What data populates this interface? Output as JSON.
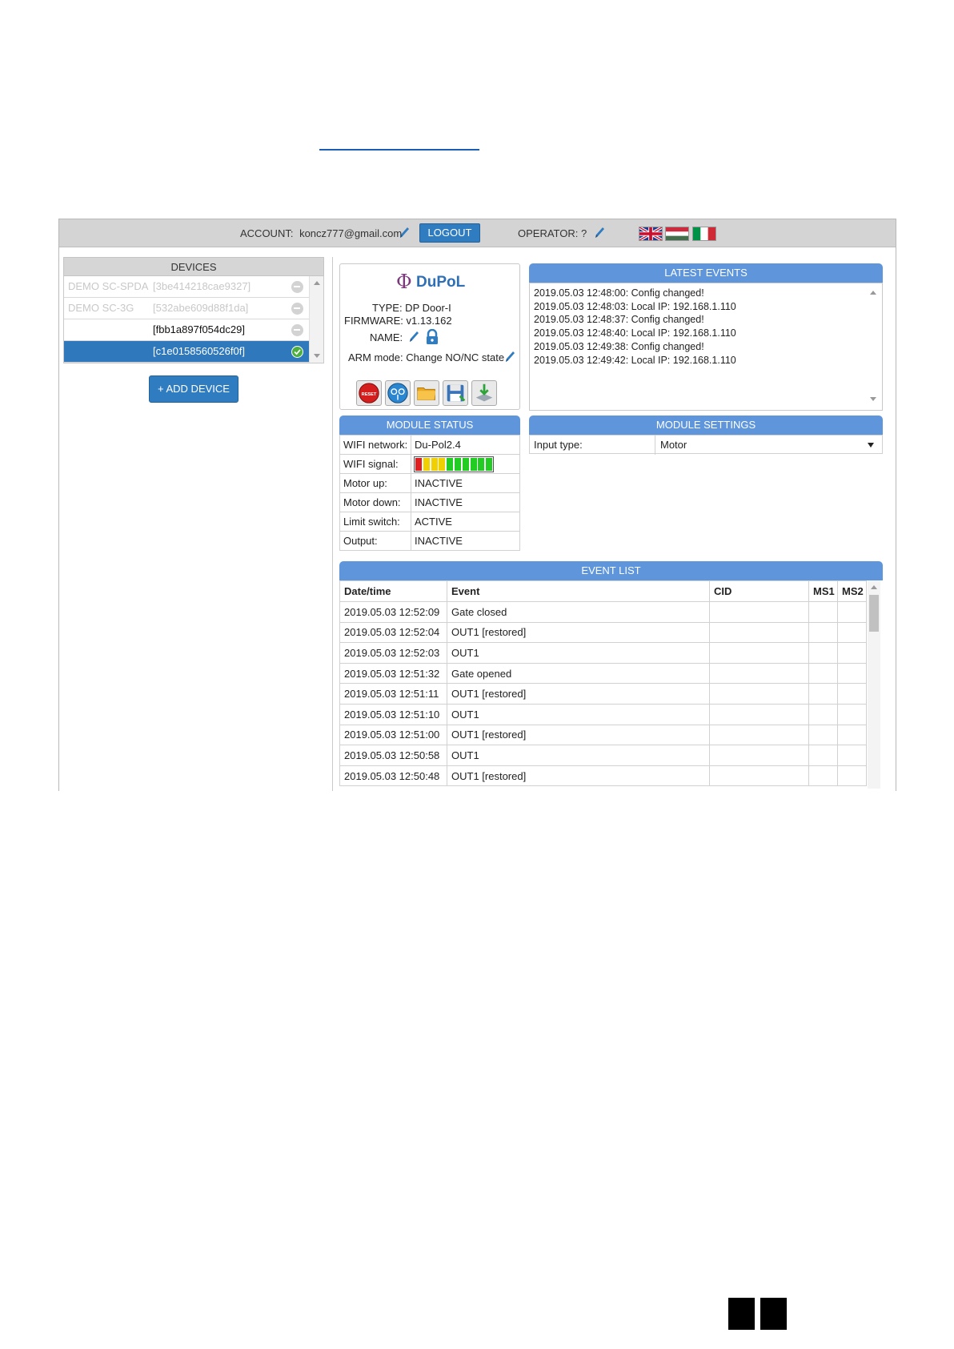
{
  "topbar": {
    "account_label": "ACCOUNT:",
    "account_email": "koncz777@gmail.com",
    "logout_label": "LOGOUT",
    "operator_label": "OPERATOR: ?",
    "languages": [
      "English",
      "Hungarian",
      "Italian"
    ]
  },
  "devices": {
    "title": "DEVICES",
    "items": [
      {
        "name": "DEMO SC-SPDA",
        "id": "[3be414218cae9327]",
        "status": "inactive"
      },
      {
        "name": "DEMO SC-3G",
        "id": "[532abe609d88f1da]",
        "status": "inactive"
      },
      {
        "name": "",
        "id": "[fbb1a897f054dc29]",
        "status": "inactive"
      },
      {
        "name": "",
        "id": "[c1e0158560526f0f]",
        "status": "online"
      }
    ],
    "add_label": "+ ADD DEVICE"
  },
  "device_info": {
    "logo_text": "DuPoL",
    "type": "TYPE: DP Door-I",
    "firmware": "FIRMWARE: v1.13.162",
    "name_label": "NAME:",
    "arm_mode": "ARM mode: Change NO/NC state",
    "tools": [
      "reset-icon",
      "remote-icon",
      "folder-icon",
      "save-icon",
      "download-icon"
    ],
    "reset_text": "RESET"
  },
  "latest_events": {
    "title": "LATEST EVENTS",
    "lines": [
      "2019.05.03 12:48:00: Config changed!",
      "2019.05.03 12:48:03: Local IP: 192.168.1.110",
      "2019.05.03 12:48:37: Config changed!",
      "2019.05.03 12:48:40: Local IP: 192.168.1.110",
      "2019.05.03 12:49:38: Config changed!",
      "2019.05.03 12:49:42: Local IP: 192.168.1.110"
    ]
  },
  "module_status": {
    "title": "MODULE STATUS",
    "rows": [
      {
        "key": "WIFI network:",
        "value": "Du-Pol2.4"
      },
      {
        "key": "WIFI signal:",
        "value": ""
      },
      {
        "key": "Motor up:",
        "value": "INACTIVE"
      },
      {
        "key": "Motor down:",
        "value": "INACTIVE"
      },
      {
        "key": "Limit switch:",
        "value": "ACTIVE"
      },
      {
        "key": "Output:",
        "value": "INACTIVE"
      }
    ],
    "wifi_signal_bars": 10,
    "signal_colors": [
      "#e02020",
      "#f0d000",
      "#f0d000",
      "#f0d000",
      "#22cc22",
      "#22cc22",
      "#22cc22",
      "#22cc22",
      "#22cc22",
      "#22cc22"
    ]
  },
  "module_settings": {
    "title": "MODULE SETTINGS",
    "input_type_label": "Input type:",
    "input_type_value": "Motor"
  },
  "event_list": {
    "title": "EVENT LIST",
    "columns": [
      "Date/time",
      "Event",
      "CID",
      "MS1",
      "MS2"
    ],
    "rows": [
      [
        "2019.05.03 12:52:09",
        "Gate closed",
        "",
        "",
        ""
      ],
      [
        "2019.05.03 12:52:04",
        "OUT1 [restored]",
        "",
        "",
        ""
      ],
      [
        "2019.05.03 12:52:03",
        "OUT1",
        "",
        "",
        ""
      ],
      [
        "2019.05.03 12:51:32",
        "Gate opened",
        "",
        "",
        ""
      ],
      [
        "2019.05.03 12:51:11",
        "OUT1 [restored]",
        "",
        "",
        ""
      ],
      [
        "2019.05.03 12:51:10",
        "OUT1",
        "",
        "",
        ""
      ],
      [
        "2019.05.03 12:51:00",
        "OUT1 [restored]",
        "",
        "",
        ""
      ],
      [
        "2019.05.03 12:50:58",
        "OUT1",
        "",
        "",
        ""
      ],
      [
        "2019.05.03 12:50:48",
        "OUT1 [restored]",
        "",
        "",
        ""
      ]
    ]
  },
  "colors": {
    "accent_blue": "#2f7cc0",
    "header_blue": "#5e95db",
    "topbar_gray": "#d4d4d4"
  }
}
